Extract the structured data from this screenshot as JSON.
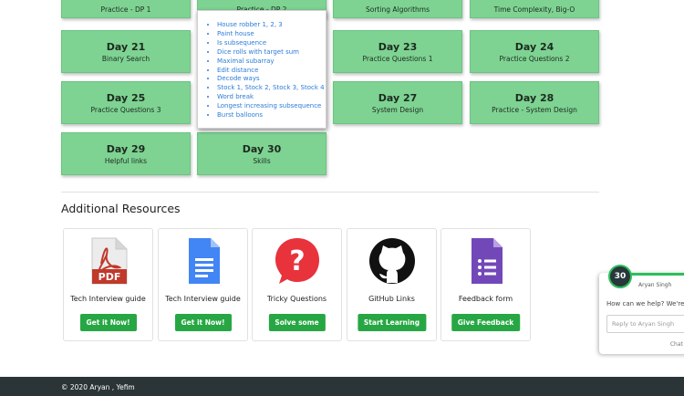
{
  "tiles_top": [
    {
      "sub": "Practice - DP 1"
    },
    {
      "sub": "Practice - DP 2"
    },
    {
      "sub": "Sorting Algorithms"
    },
    {
      "sub": "Time Complexity, Big-O"
    }
  ],
  "tiles": [
    {
      "day": "Day 21",
      "sub": "Binary Search"
    },
    {
      "day": "Day 23",
      "sub": "Practice Questions 1"
    },
    {
      "day": "Day 24",
      "sub": "Practice Questions 2"
    },
    {
      "day": "Day 25",
      "sub": "Practice Questions 3"
    },
    {
      "day": "Day 27",
      "sub": "System Design"
    },
    {
      "day": "Day 28",
      "sub": "Practice - System Design"
    },
    {
      "day": "Day 29",
      "sub": "Helpful links"
    },
    {
      "day": "Day 30",
      "sub": "Skills"
    }
  ],
  "popup_items": [
    "House robber 1, 2, 3",
    "Paint house",
    "Is subsequence",
    "Dice rolls with target sum",
    "Maximal subarray",
    "Edit distance",
    "Decode ways",
    "Stock 1, Stock 2, Stock 3, Stock 4",
    "Word break",
    "Longest increasing subsequence",
    "Burst balloons"
  ],
  "resources_heading": "Additional Resources",
  "resources": [
    {
      "title": "Tech Interview guide",
      "button": "Get it Now!",
      "icon": "pdf-icon"
    },
    {
      "title": "Tech Interview guide",
      "button": "Get it Now!",
      "icon": "google-docs-icon"
    },
    {
      "title": "Tricky Questions",
      "button": "Solve some",
      "icon": "question-bubble-icon"
    },
    {
      "title": "GitHub Links",
      "button": "Start Learning",
      "icon": "github-icon"
    },
    {
      "title": "Feedback form",
      "button": "Give Feedback",
      "icon": "google-forms-icon"
    }
  ],
  "footer": {
    "copyright": "© 2020 Aryan , Yefim"
  },
  "chat": {
    "avatar_text": "30",
    "agent_name": "Aryan Singh",
    "question": "How can we help? We're h",
    "reply_placeholder": "Reply to Aryan Singh",
    "brand": "Chat",
    "brand_bolt": "⚡"
  },
  "colors": {
    "tile": "#7ed392",
    "button": "#27a744",
    "link": "#2a7cd9",
    "footer": "#2b3437"
  }
}
